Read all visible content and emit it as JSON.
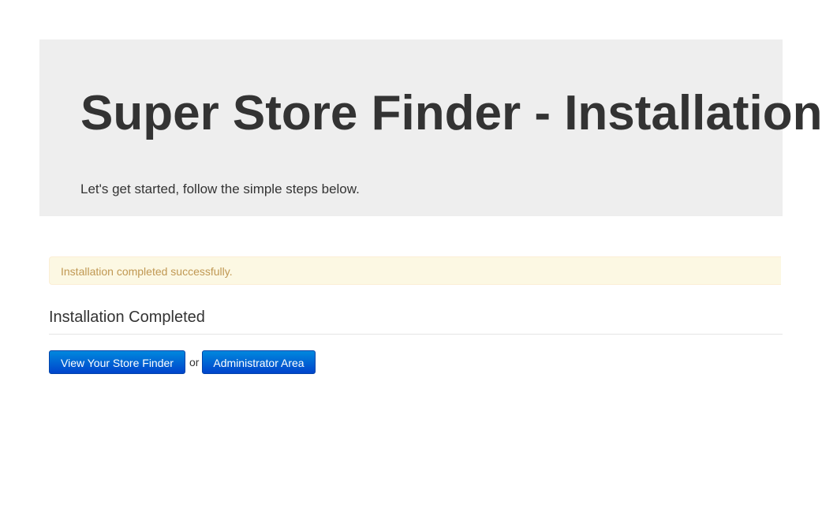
{
  "header": {
    "title": "Super Store Finder - Installation",
    "subtitle": "Let's get started, follow the simple steps below."
  },
  "alert": {
    "text": "Installation completed successfully.",
    "color": "#c09853",
    "background": "#fcf8e3"
  },
  "section": {
    "title": "Installation Completed"
  },
  "actions": {
    "view_label": "View Your Store Finder",
    "separator": "or",
    "admin_label": "Administrator Area",
    "button_color": "#0066cc"
  }
}
